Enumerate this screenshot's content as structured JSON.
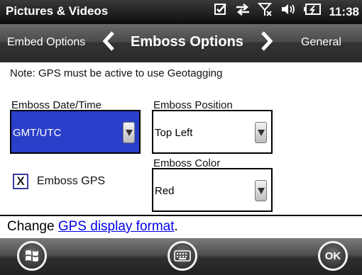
{
  "titlebar": {
    "title": "Pictures & Videos",
    "clock": "11:38",
    "icons": [
      "notification-checkbox-icon",
      "sync-arrows-icon",
      "signal-off-icon",
      "volume-icon",
      "battery-charging-icon"
    ]
  },
  "tabs": {
    "previous": "Embed Options",
    "current": "Emboss Options",
    "next": "General"
  },
  "note": "Note: GPS must be active to use Geotagging",
  "fields": {
    "datetime_label": "Emboss Date/Time",
    "datetime_value": "GMT/UTC",
    "position_label": "Emboss Position",
    "position_value": "Top Left",
    "color_label": "Emboss Color",
    "color_value": "Red"
  },
  "gps_checkbox": {
    "label": "Emboss GPS",
    "checked": true,
    "mark": "X"
  },
  "footer": {
    "prefix": "Change ",
    "link": "GPS display format",
    "suffix": "."
  },
  "softkeys": {
    "ok": "OK"
  },
  "colors": {
    "selection": "#2a3fc9",
    "link": "#0000ee"
  }
}
